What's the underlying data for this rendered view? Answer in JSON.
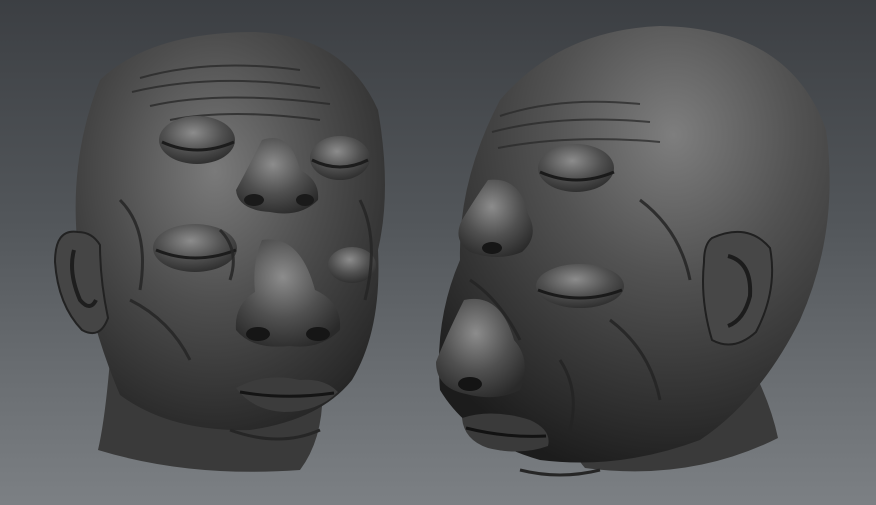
{
  "scene": {
    "background_top": "#3c3f43",
    "background_bottom": "#7c8084",
    "material_base": "#4a4a4a",
    "material_highlight": "#8a8a8a",
    "material_shadow": "#1c1c1c"
  }
}
